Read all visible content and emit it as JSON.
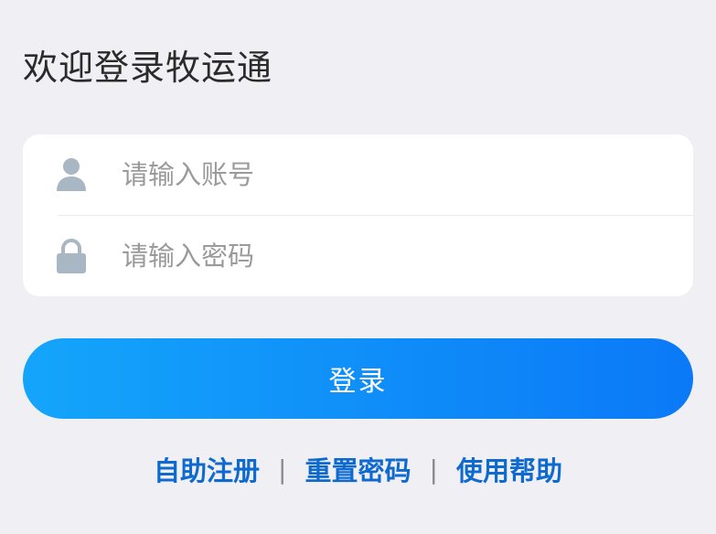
{
  "header": {
    "title": "欢迎登录牧运通"
  },
  "form": {
    "account": {
      "placeholder": "请输入账号",
      "icon": "user-icon"
    },
    "password": {
      "placeholder": "请输入密码",
      "icon": "lock-icon"
    }
  },
  "actions": {
    "login_label": "登录"
  },
  "links": {
    "register": "自助注册",
    "reset_password": "重置密码",
    "help": "使用帮助",
    "separator": "|"
  },
  "colors": {
    "background": "#efeff4",
    "button_gradient_start": "#14a5fb",
    "button_gradient_end": "#0b79f7",
    "link": "#0f6ad0",
    "icon": "#a9b7c4"
  }
}
